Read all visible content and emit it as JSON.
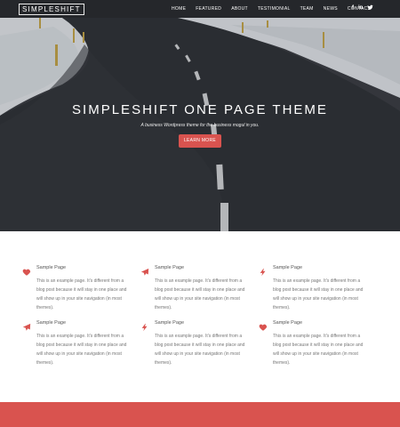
{
  "header": {
    "logo": "SIMPLESHIFT",
    "nav": [
      "HOME",
      "FEATURED",
      "ABOUT",
      "TESTIMONIAL",
      "TEAM",
      "NEWS",
      "CONTACT"
    ],
    "social": [
      {
        "icon": "facebook-icon",
        "glyph": "f"
      },
      {
        "icon": "linkedin-icon",
        "glyph": "in"
      },
      {
        "icon": "twitter-icon",
        "glyph": "🐦"
      }
    ]
  },
  "hero": {
    "title": "SIMPLESHIFT ONE PAGE THEME",
    "subtitle": "A business Wordpress theme for the business mogul in you.",
    "button": "LEARN MORE"
  },
  "features": [
    {
      "icon": "heart-icon",
      "title": "Sample Page",
      "text": "This is an example page. It's different from a blog post because it will stay in one place and will show up in your site navigation (in most themes)."
    },
    {
      "icon": "paper-plane-icon",
      "title": "Sample Page",
      "text": "This is an example page. It's different from a blog post because it will stay in one place and will show up in your site navigation (in most themes)."
    },
    {
      "icon": "lightning-icon",
      "title": "Sample Page",
      "text": "This is an example page. It's different from a blog post because it will stay in one place and will show up in your site navigation (in most themes)."
    },
    {
      "icon": "paper-plane-icon",
      "title": "Sample Page",
      "text": "This is an example page. It's different from a blog post because it will stay in one place and will show up in your site navigation (in most themes)."
    },
    {
      "icon": "lightning-icon",
      "title": "Sample Page",
      "text": "This is an example page. It's different from a blog post because it will stay in one place and will show up in your site navigation (in most themes)."
    },
    {
      "icon": "heart-icon",
      "title": "Sample Page",
      "text": "This is an example page. It's different from a blog post because it will stay in one place and will show up in your site navigation (in most themes)."
    }
  ],
  "colors": {
    "accent": "#d9534f",
    "text": "#777777",
    "heading": "#555555"
  }
}
